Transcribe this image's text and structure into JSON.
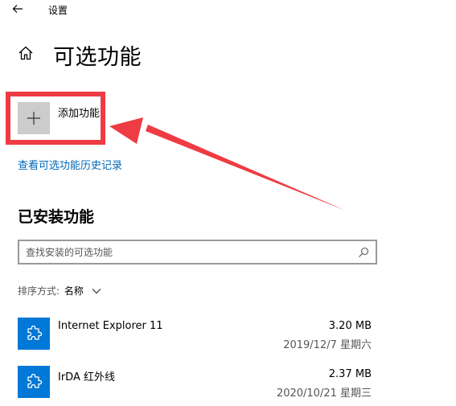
{
  "window": {
    "title": "设置"
  },
  "page": {
    "title": "可选功能"
  },
  "add_feature": {
    "label": "添加功能"
  },
  "history_link": {
    "label": "查看可选功能历史记录"
  },
  "installed": {
    "title": "已安装功能",
    "search_placeholder": "查找安装的可选功能",
    "sort_label": "排序方式:",
    "sort_value": "名称",
    "items": [
      {
        "name": "Internet Explorer 11",
        "size": "3.20 MB",
        "date": "2019/12/7 星期六"
      },
      {
        "name": "IrDA 红外线",
        "size": "2.37 MB",
        "date": "2020/10/21 星期三"
      }
    ]
  },
  "colors": {
    "accent": "#0078d7",
    "link": "#0067b8",
    "annotation": "#ef3b43",
    "tile_gray": "#cccccc"
  },
  "icons": {
    "back": "back-arrow-icon",
    "home": "home-icon",
    "add": "plus-icon",
    "search": "search-icon",
    "sort": "chevron-down-icon",
    "feature": "puzzle-piece-icon"
  }
}
